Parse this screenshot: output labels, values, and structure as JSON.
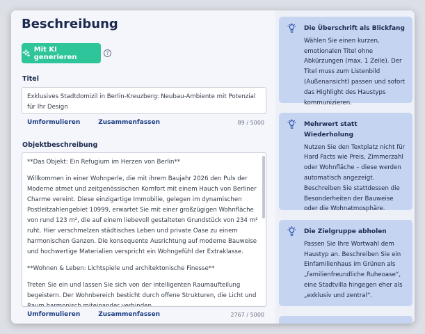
{
  "main": {
    "title": "Beschreibung",
    "ai_button": "Mit KI generieren",
    "help_glyph": "?",
    "title_field": {
      "label": "Titel",
      "value": "Exklusives Stadtdomizil in Berlin-Kreuzberg: Neubau-Ambiente mit Potenzial für Ihr Design",
      "rephrase": "Umformulieren",
      "summarize": "Zusammenfassen",
      "counter": "89 / 5000"
    },
    "description_field": {
      "label": "Objektbeschreibung",
      "paragraphs": [
        "**Das Objekt: Ein Refugium im Herzen von Berlin**",
        "Willkommen in einer Wohnperle, die mit ihrem Baujahr 2026 den Puls der Moderne atmet und zeitgenössischen Komfort mit einem Hauch von Berliner Charme vereint. Diese einzigartige Immobilie, gelegen im dynamischen Postleitzahlengebiet 10999, erwartet Sie mit einer großzügigen Wohnfläche von rund 123 m², die auf einem liebevoll gestalteten Grundstück von 234 m² ruht. Hier verschmelzen städtisches Leben und private Oase zu einem harmonischen Ganzen. Die konsequente Ausrichtung auf moderne Bauweise und hochwertige Materialien verspricht ein Wohngefühl der Extraklasse.",
        "**Wohnen & Leben: Lichtspiele und architektonische Finesse**",
        "Treten Sie ein und lassen Sie sich von der intelligenten Raumaufteilung begeistern. Der Wohnbereich besticht durch offene Strukturen, die Licht und Raum harmonisch miteinander verbinden."
      ],
      "rephrase": "Umformulieren",
      "summarize": "Zusammenfassen",
      "counter": "2767 / 5000"
    }
  },
  "sidebar": {
    "tips": [
      {
        "heading": "Die Überschrift als Blickfang",
        "body": "Wählen Sie einen kurzen, emotionalen Titel ohne Abkürzungen (max. 1 Zeile). Der Titel muss zum Listenbild (Außenansicht) passen und sofort das Highlight des Haustyps kommunizieren."
      },
      {
        "heading": "Mehrwert statt Wiederholung",
        "body": "Nutzen Sie den Textplatz nicht für Hard Facts wie Preis, Zimmerzahl oder Wohnfläche – diese werden automatisch angezeigt. Beschreiben Sie stattdessen die Besonderheiten der Bauweise oder die Wohnatmosphäre."
      },
      {
        "heading": "Die Zielgruppe abholen",
        "body": "Passen Sie Ihre Wortwahl dem Haustyp an. Beschreiben Sie ein Einfamilienhaus im Grünen als „familienfreundliche Ruheoase“, eine Stadtvilla hingegen eher als „exklusiv und zentral“."
      }
    ]
  },
  "colors": {
    "accent": "#2ec59a",
    "heading": "#1d2a4f",
    "link": "#1d3f86",
    "tip_background": "#c5d4f1"
  }
}
